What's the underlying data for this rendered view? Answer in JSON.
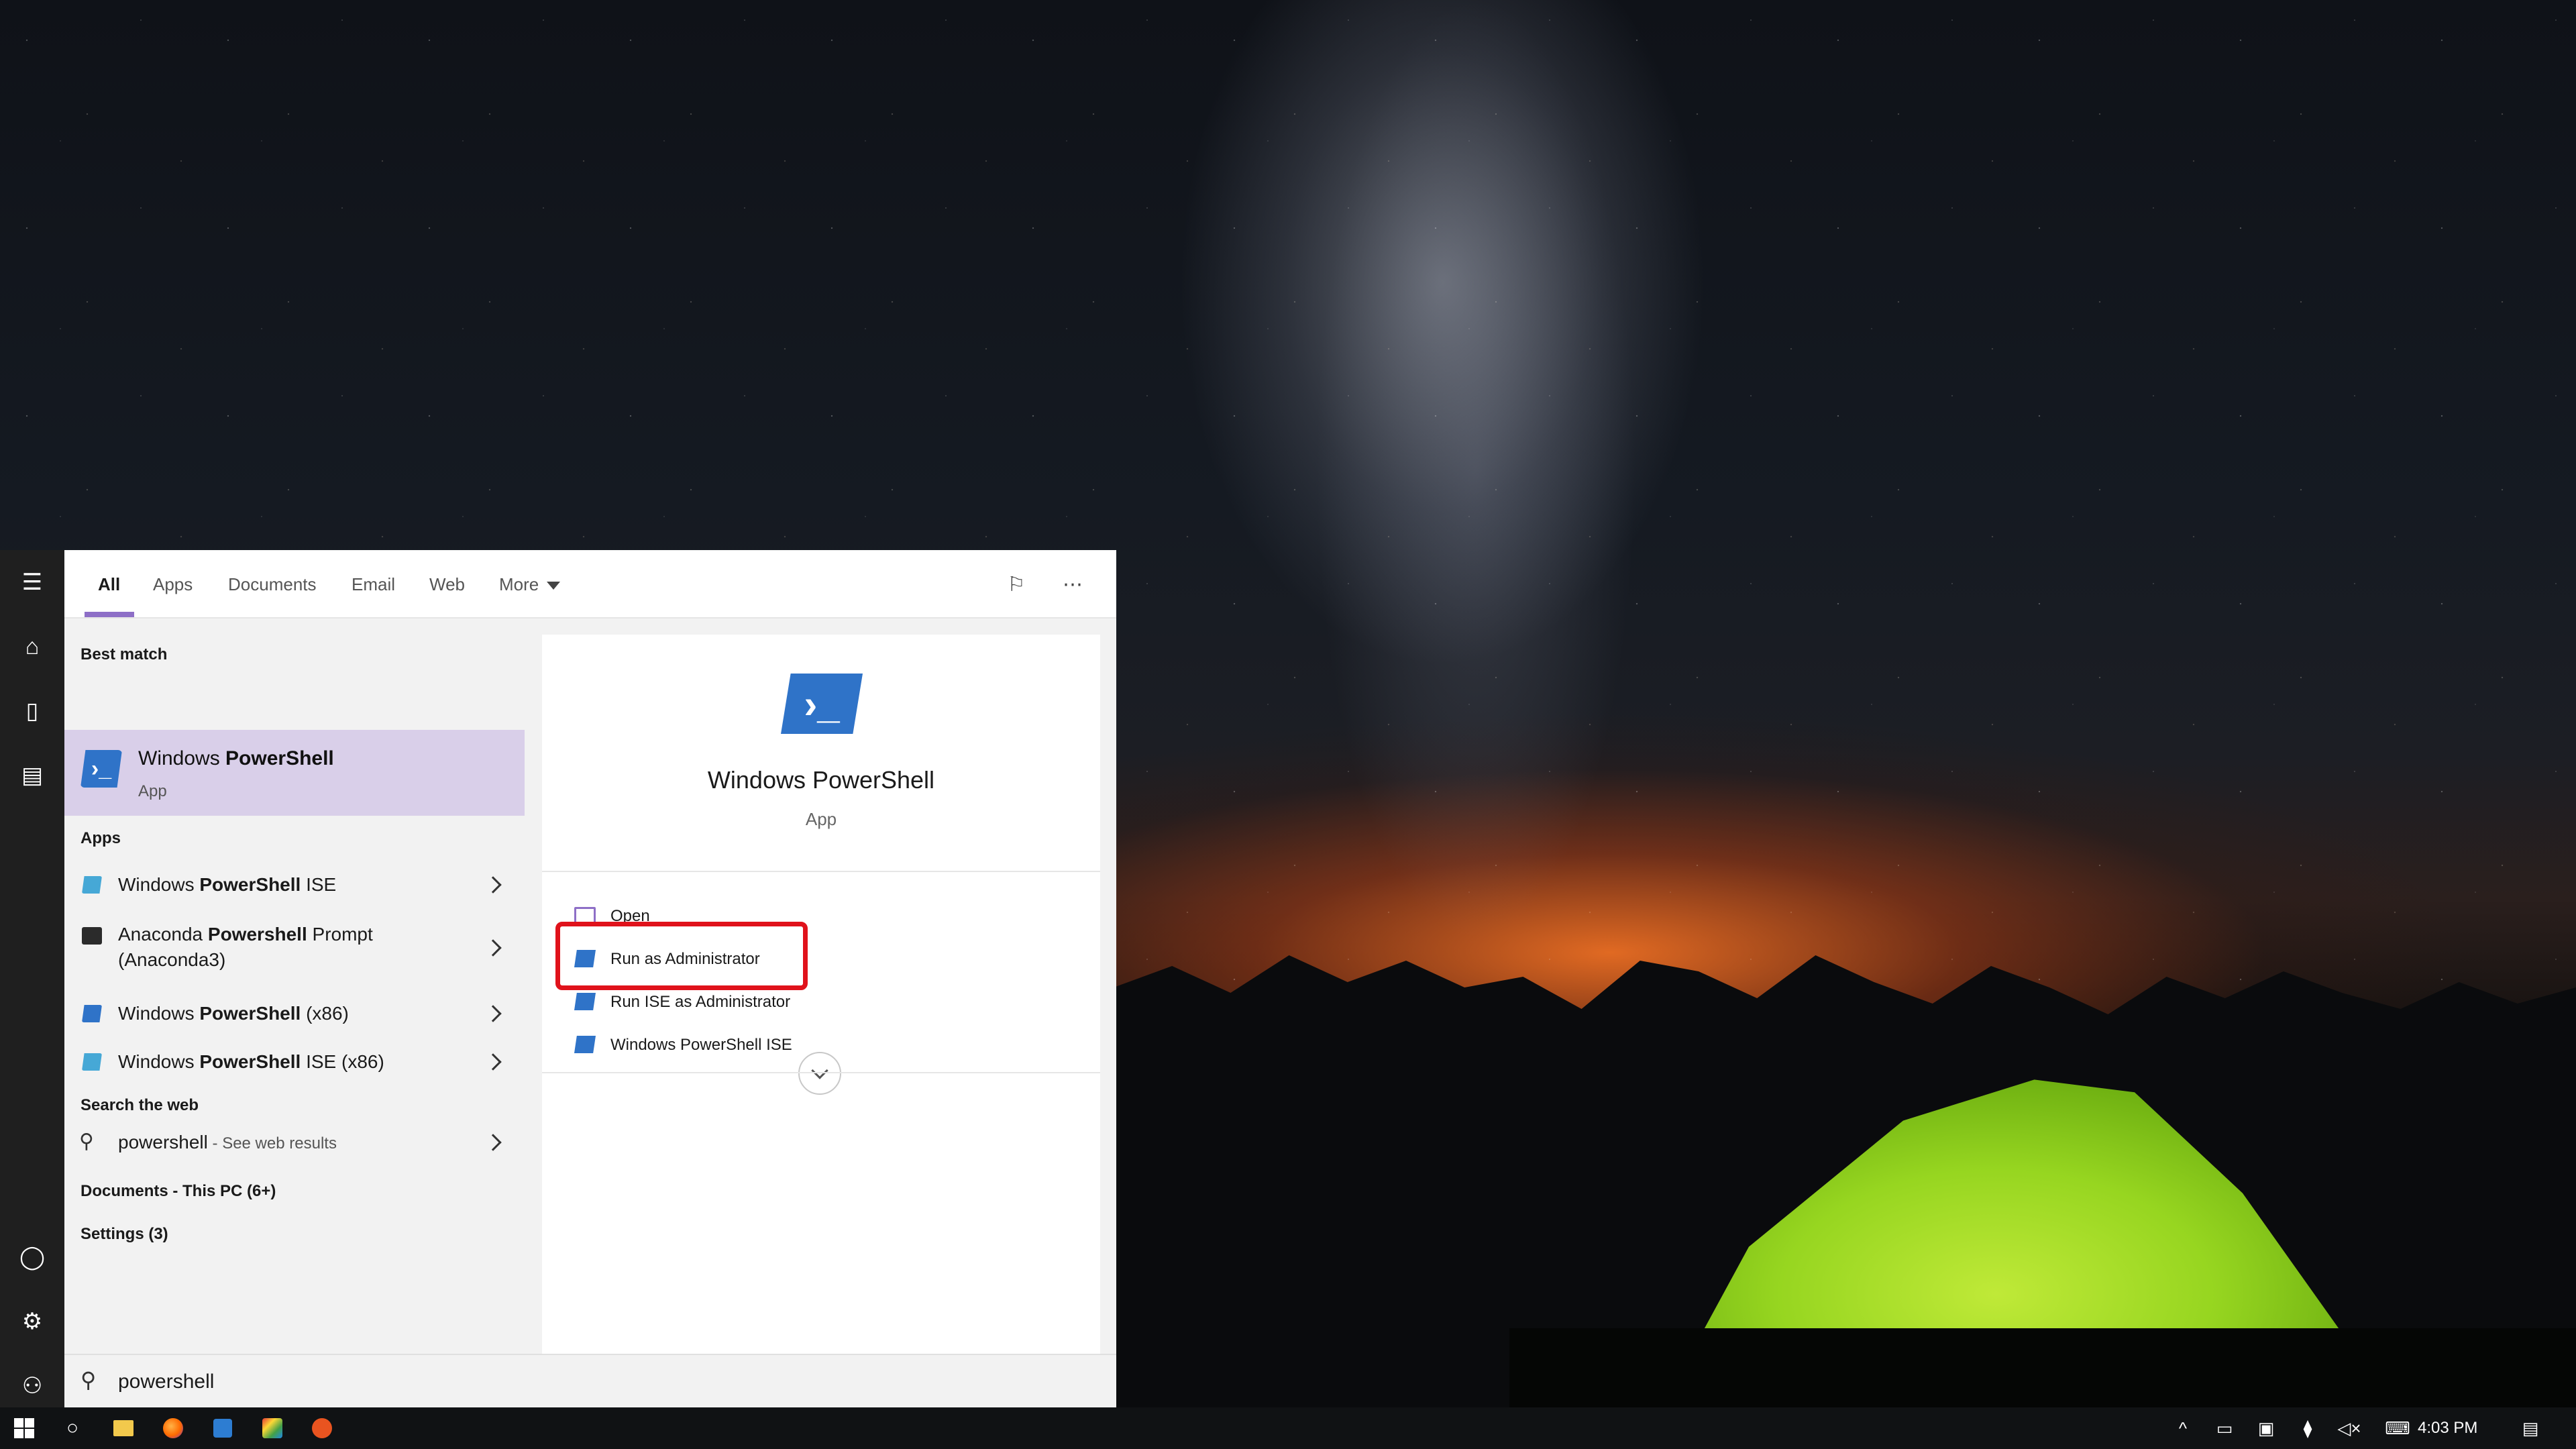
{
  "tabs": [
    {
      "label": "All"
    },
    {
      "label": "Apps"
    },
    {
      "label": "Documents"
    },
    {
      "label": "Email"
    },
    {
      "label": "Web"
    },
    {
      "label": "More"
    }
  ],
  "header_icons": {
    "feedback": "feedback-icon",
    "more": "⋯"
  },
  "rail_icons": [
    "hamburger-icon",
    "home-icon",
    "documents-icon",
    "photos-icon",
    "user-icon",
    "settings-icon",
    "power-user-icon"
  ],
  "best_match": {
    "header": "Best match",
    "title_prefix": "Windows ",
    "title_bold": "PowerShell",
    "subtitle": "App"
  },
  "apps": {
    "header": "Apps",
    "items": [
      {
        "pre": "Windows ",
        "bold": "PowerShell",
        "post": " ISE",
        "line2": "",
        "icon_color": "#46a8d6"
      },
      {
        "pre": "Anaconda ",
        "bold": "Powershell",
        "post": " Prompt",
        "line2": "(Anaconda3)",
        "icon_color": "#2b2b2b"
      },
      {
        "pre": "Windows ",
        "bold": "PowerShell",
        "post": " (x86)",
        "line2": "",
        "icon_color": "#2f73c8"
      },
      {
        "pre": "Windows ",
        "bold": "PowerShell",
        "post": " ISE (x86)",
        "line2": "",
        "icon_color": "#46a8d6"
      }
    ]
  },
  "web": {
    "header": "Search the web",
    "query": "powershell",
    "suffix": " - See web results"
  },
  "documents_header": "Documents - This PC (6+)",
  "settings_header": "Settings (3)",
  "detail": {
    "title": "Windows PowerShell",
    "subtitle": "App",
    "actions": [
      {
        "label": "Open"
      },
      {
        "label": "Run as Administrator"
      },
      {
        "label": "Run ISE as Administrator"
      },
      {
        "label": "Windows PowerShell ISE"
      }
    ]
  },
  "search": {
    "value": "powershell"
  },
  "taskbar": {
    "apps": [
      "windows-start-icon",
      "cortana-icon",
      "file-explorer-icon",
      "firefox-icon",
      "app-icon",
      "paint-icon",
      "ubuntu-icon"
    ],
    "time": "4:03 PM"
  },
  "colors": {
    "accent": "#8e6fc7",
    "highlight": "#d9cfe9",
    "annotation": "#e0121b",
    "powershell": "#2f73c8"
  }
}
